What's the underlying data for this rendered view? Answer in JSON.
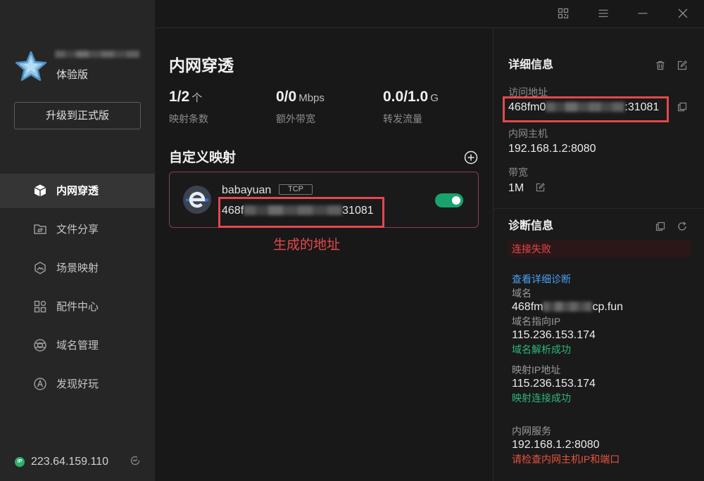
{
  "window": {
    "qr_icon": "qrcode-icon",
    "menu_icon": "menu-icon",
    "minimize_icon": "minimize-icon",
    "close_icon": "close-icon"
  },
  "user": {
    "avatar_icon": "star-avatar-icon",
    "edition": "体验版",
    "upgrade_label": "升级到正式版"
  },
  "sidebar": {
    "items": [
      {
        "label": "内网穿透",
        "icon": "cube-icon",
        "active": true
      },
      {
        "label": "文件分享",
        "icon": "folder-share-icon",
        "active": false
      },
      {
        "label": "场景映射",
        "icon": "scene-map-icon",
        "active": false
      },
      {
        "label": "配件中心",
        "icon": "accessory-grid-icon",
        "active": false
      },
      {
        "label": "域名管理",
        "icon": "domain-globe-icon",
        "active": false
      },
      {
        "label": "发现好玩",
        "icon": "discover-icon",
        "active": false
      }
    ]
  },
  "status": {
    "ip_badge": "IP",
    "public_ip": "223.64.159.110",
    "check_icon": "network-check-icon"
  },
  "main": {
    "title": "内网穿透",
    "stats": [
      {
        "value": "1/2",
        "unit": "个",
        "label": "映射条数"
      },
      {
        "value": "0/0",
        "unit": "Mbps",
        "label": "额外带宽"
      },
      {
        "value": "0.0/1.0",
        "unit": "G",
        "label": "转发流量"
      }
    ],
    "section_title": "自定义映射",
    "add_icon": "plus-circle-icon",
    "mapping": {
      "app_icon": "browser-e-icon",
      "name": "babayuan",
      "protocol": "TCP",
      "address_prefix": "468f",
      "address_suffix": "31081",
      "enabled": true
    },
    "annotation_label": "生成的地址"
  },
  "details": {
    "title": "详细信息",
    "access_address_label": "访问地址",
    "access_address_prefix": "468fm0",
    "access_address_suffix": ":31081",
    "local_host_label": "内网主机",
    "local_host": "192.168.1.2:8080",
    "bandwidth_label": "带宽",
    "bandwidth": "1M"
  },
  "diagnosis": {
    "title": "诊断信息",
    "status": "连接失败",
    "detail_link": "查看详细诊断",
    "domain_label": "域名",
    "domain_prefix": "468fm",
    "domain_suffix": "cp.fun",
    "domain_ip_label": "域名指向IP",
    "domain_ip": "115.236.153.174",
    "domain_ip_result": "域名解析成功",
    "mapping_ip_label": "映射IP地址",
    "mapping_ip": "115.236.153.174",
    "mapping_ip_result": "映射连接成功",
    "local_service_label": "内网服务",
    "local_service": "192.168.1.2:8080",
    "local_service_result": "请检查内网主机IP和端口"
  },
  "colors": {
    "sidebar_bg": "#262626",
    "main_bg": "#181818",
    "active_nav_bg": "#353535",
    "toggle_on": "#18a36e",
    "success": "#2fb57a",
    "error": "#e5484d",
    "link": "#4a9ff5",
    "annotation": "#e5484d",
    "ip_badge": "#2fae6c"
  }
}
